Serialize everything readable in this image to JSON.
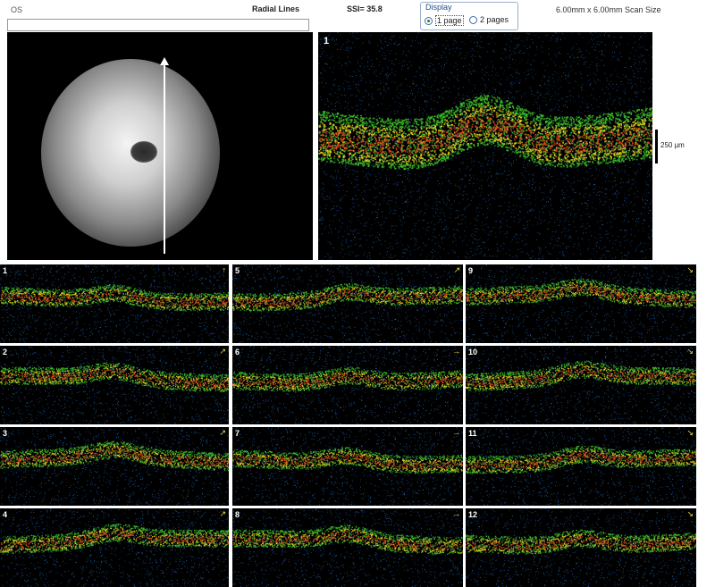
{
  "header": {
    "eye": "OS",
    "scan_type": "Radial Lines",
    "ssi": "SSI= 35.8",
    "display_label": "Display",
    "option_1": "1 page",
    "option_2": "2 pages",
    "scan_size": "6.00mm x 6.00mm Scan Size"
  },
  "main_scan": {
    "number": "1"
  },
  "scale": {
    "label": "250 µm"
  },
  "colors": {
    "retina_high": "#e8501e",
    "retina_mid": "#f0d020",
    "retina_low": "#3fbf2a",
    "noise": "#2a7ad8"
  },
  "thumbnails": [
    {
      "number": "1",
      "arrow": "↑"
    },
    {
      "number": "2",
      "arrow": "↗"
    },
    {
      "number": "3",
      "arrow": "↗"
    },
    {
      "number": "4",
      "arrow": "↗"
    },
    {
      "number": "5",
      "arrow": "↗"
    },
    {
      "number": "6",
      "arrow": "→"
    },
    {
      "number": "7",
      "arrow": "→"
    },
    {
      "number": "8",
      "arrow": "→"
    },
    {
      "number": "9",
      "arrow": "↘"
    },
    {
      "number": "10",
      "arrow": "↘"
    },
    {
      "number": "11",
      "arrow": "↘"
    },
    {
      "number": "12",
      "arrow": "↘"
    }
  ]
}
